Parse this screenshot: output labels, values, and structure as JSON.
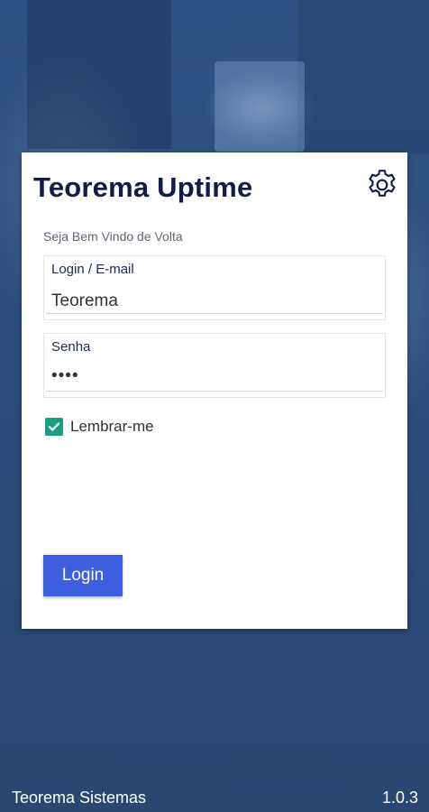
{
  "app": {
    "title": "Teorema Uptime",
    "welcome": "Seja Bem Vindo de Volta"
  },
  "login_field": {
    "label": "Login / E-mail",
    "value": "Teorema"
  },
  "password_field": {
    "label": "Senha",
    "value": "••••"
  },
  "remember": {
    "label": "Lembrar-me",
    "checked": true
  },
  "buttons": {
    "login_label": "Login"
  },
  "footer": {
    "company": "Teorema Sistemas",
    "version": "1.0.3"
  },
  "icons": {
    "settings": "gear-icon",
    "checkbox": "check-icon"
  },
  "colors": {
    "title": "#121c49",
    "accent_button": "#3d5fe0",
    "checkbox": "#1a9e84",
    "background": "#2b4e7d"
  }
}
